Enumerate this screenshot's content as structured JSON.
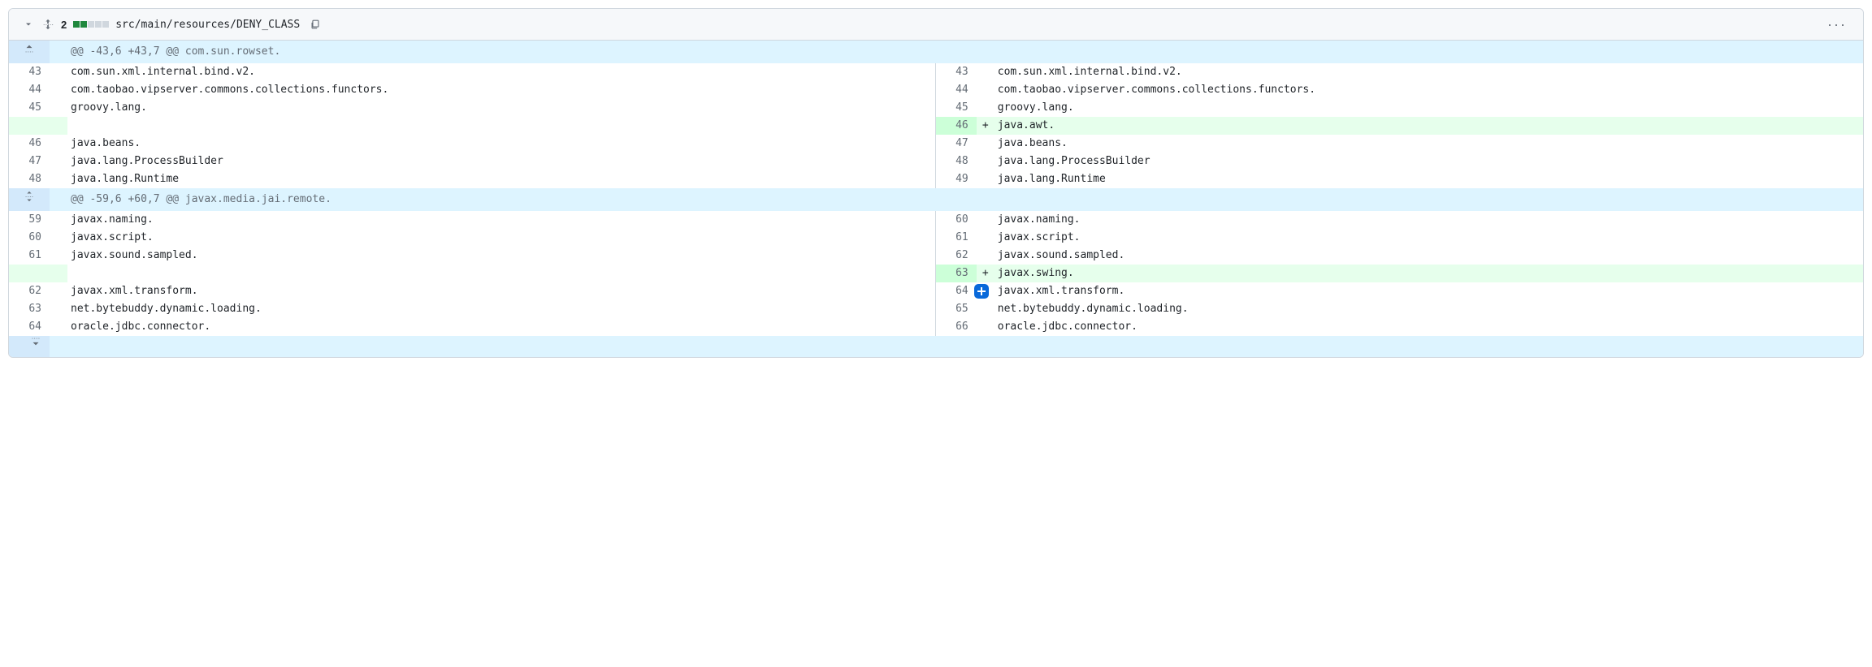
{
  "file": {
    "path": "src/main/resources/DENY_CLASS",
    "changes_count": "2",
    "diffstat": {
      "added": 2,
      "neutral": 3
    }
  },
  "hunks": [
    {
      "header": "@@ -43,6 +43,7 @@ com.sun.rowset.",
      "expand_direction": "up",
      "rows": [
        {
          "type": "ctx",
          "ln_left": "43",
          "ln_right": "43",
          "left": "com.sun.xml.internal.bind.v2.",
          "right": "com.sun.xml.internal.bind.v2."
        },
        {
          "type": "ctx",
          "ln_left": "44",
          "ln_right": "44",
          "left": "com.taobao.vipserver.commons.collections.functors.",
          "right": "com.taobao.vipserver.commons.collections.functors."
        },
        {
          "type": "ctx",
          "ln_left": "45",
          "ln_right": "45",
          "left": "groovy.lang.",
          "right": "groovy.lang."
        },
        {
          "type": "add",
          "ln_left": "",
          "ln_right": "46",
          "left": "",
          "right": "java.awt."
        },
        {
          "type": "ctx",
          "ln_left": "46",
          "ln_right": "47",
          "left": "java.beans.",
          "right": "java.beans."
        },
        {
          "type": "ctx",
          "ln_left": "47",
          "ln_right": "48",
          "left": "java.lang.ProcessBuilder",
          "right": "java.lang.ProcessBuilder"
        },
        {
          "type": "ctx",
          "ln_left": "48",
          "ln_right": "49",
          "left": "java.lang.Runtime",
          "right": "java.lang.Runtime"
        }
      ]
    },
    {
      "header": "@@ -59,6 +60,7 @@ javax.media.jai.remote.",
      "expand_direction": "both",
      "rows": [
        {
          "type": "ctx",
          "ln_left": "59",
          "ln_right": "60",
          "left": "javax.naming.",
          "right": "javax.naming."
        },
        {
          "type": "ctx",
          "ln_left": "60",
          "ln_right": "61",
          "left": "javax.script.",
          "right": "javax.script."
        },
        {
          "type": "ctx",
          "ln_left": "61",
          "ln_right": "62",
          "left": "javax.sound.sampled.",
          "right": "javax.sound.sampled."
        },
        {
          "type": "add",
          "ln_left": "",
          "ln_right": "63",
          "left": "",
          "right": "javax.swing."
        },
        {
          "type": "ctx",
          "ln_left": "62",
          "ln_right": "64",
          "left": "javax.xml.transform.",
          "right": "javax.xml.transform.",
          "has_comment_btn": true
        },
        {
          "type": "ctx",
          "ln_left": "63",
          "ln_right": "65",
          "left": "net.bytebuddy.dynamic.loading.",
          "right": "net.bytebuddy.dynamic.loading."
        },
        {
          "type": "ctx",
          "ln_left": "64",
          "ln_right": "66",
          "left": "oracle.jdbc.connector.",
          "right": "oracle.jdbc.connector."
        }
      ]
    }
  ],
  "trailing_expand": true
}
